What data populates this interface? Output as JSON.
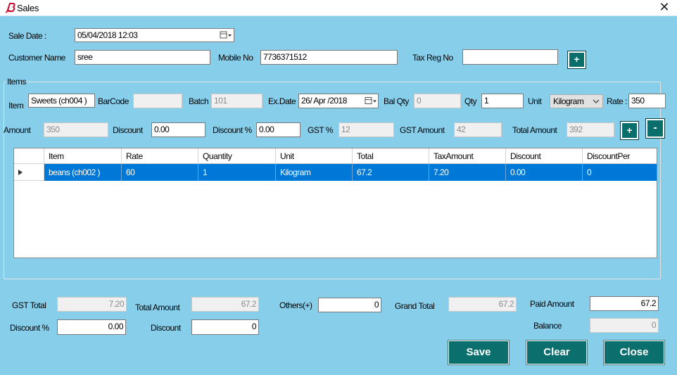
{
  "window": {
    "title": "Sales",
    "close_glyph": "✕",
    "icon": "app-logo-icon",
    "accent": "#0a6e6a"
  },
  "header": {
    "sale_date_label": "Sale Date :",
    "sale_date_value": "05/04/2018 12:03",
    "customer_name_label": "Customer Name",
    "customer_name_value": "sree",
    "mobile_label": "Mobile No",
    "mobile_value": "7736371512",
    "tax_reg_label": "Tax Reg No",
    "tax_reg_value": "",
    "add_customer_label": "+"
  },
  "items": {
    "group_label": "Items",
    "item_label": "Item",
    "item_value": "Sweets (ch004 )",
    "barcode_label": "BarCode",
    "barcode_value": "",
    "batch_label": "Batch",
    "batch_value": "101",
    "exdate_label": "Ex.Date",
    "exdate_value": "26/ Apr /2018",
    "balqty_label": "Bal Qty",
    "balqty_value": "0",
    "qty_label": "Qty",
    "qty_value": "1",
    "unit_label": "Unit",
    "unit_value": "Kilogram",
    "rate_label": "Rate :",
    "rate_value": "350",
    "amount_label": "Amount",
    "amount_value": "350",
    "discount_label": "Discount",
    "discount_value": "0.00",
    "discount_pct_label": "Discount %",
    "discount_pct_value": "0.00",
    "gst_pct_label": "GST %",
    "gst_pct_value": "12",
    "gst_amount_label": "GST Amount",
    "gst_amount_value": "42",
    "total_amount_label": "Total Amount",
    "total_amount_value": "392",
    "add_item_label": "+",
    "remove_item_label": "-"
  },
  "grid": {
    "columns": [
      "Item",
      "Rate",
      "Quantity",
      "Unit",
      "Total",
      "TaxAmount",
      "Discount",
      "DiscountPer"
    ],
    "rows": [
      [
        "beans (ch002 )",
        "60",
        "1",
        "Kilogram",
        "67.2",
        "7.20",
        "0.00",
        "0"
      ]
    ]
  },
  "footer": {
    "gst_total_label": "GST Total",
    "gst_total_value": "7.20",
    "total_amount_label": "Total Amount",
    "total_amount_value": "67.2",
    "others_label": "Others(+)",
    "others_value": "0",
    "grand_total_label": "Grand Total",
    "grand_total_value": "67.2",
    "paid_amount_label": "Paid Amount",
    "paid_amount_value": "67.2",
    "discount_pct_label": "Discount %",
    "discount_pct_value": "0.00",
    "discount_label": "Discount",
    "discount_value": "0",
    "balance_label": "Balance",
    "balance_value": "0"
  },
  "actions": {
    "save": "Save",
    "clear": "Clear",
    "close": "Close"
  }
}
